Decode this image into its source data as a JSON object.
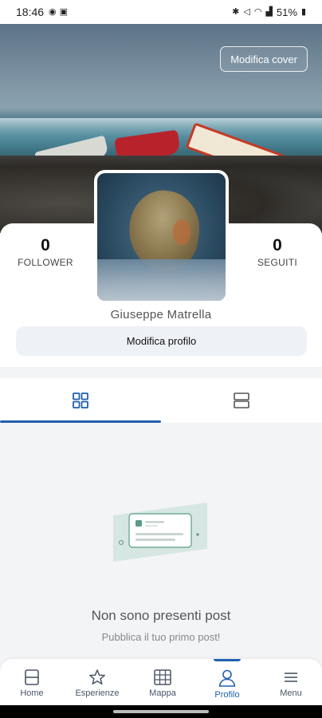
{
  "status_bar": {
    "time": "18:46",
    "battery": "51%"
  },
  "cover": {
    "edit_cover_label": "Modifica cover"
  },
  "profile": {
    "followers_count": "0",
    "followers_label": "FOLLOWER",
    "following_count": "0",
    "following_label": "SEGUITI",
    "name": "Giuseppe Matrella",
    "edit_profile_label": "Modifica profilo"
  },
  "tabs": [
    {
      "icon": "grid-icon",
      "active": true
    },
    {
      "icon": "list-icon",
      "active": false
    }
  ],
  "empty_state": {
    "title": "Non sono presenti post",
    "subtitle": "Pubblica il tuo primo post!"
  },
  "bottom_nav": {
    "items": [
      {
        "label": "Home",
        "icon": "home-icon"
      },
      {
        "label": "Esperienze",
        "icon": "star-icon"
      },
      {
        "label": "Mappa",
        "icon": "map-icon"
      },
      {
        "label": "Profilo",
        "icon": "user-icon"
      },
      {
        "label": "Menu",
        "icon": "hamburger-icon"
      }
    ],
    "active": "Profilo"
  },
  "colors": {
    "accent": "#1f5fae",
    "background": "#f3f4f6"
  }
}
